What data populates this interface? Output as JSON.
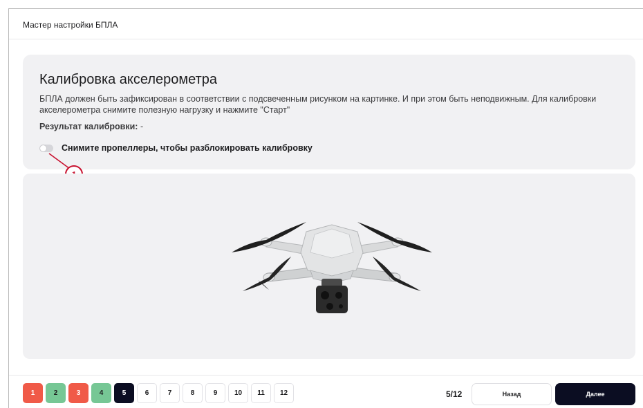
{
  "header": {
    "title": "Мастер настройки БПЛА"
  },
  "calibration": {
    "title": "Калибровка акселерометра",
    "description": "БПЛА должен быть зафиксирован в соответствии с подсвеченным рисунком на картинке. И при этом быть неподвижным. Для калибровки акселерометра снимите полезную нагрузку и нажмите \"Старт\"",
    "result_label": "Результат калибровки:",
    "result_value": "-",
    "toggle_label": "Снимите пропеллеры, чтобы разблокировать калибровку",
    "toggle_on": false
  },
  "callout": {
    "number": "1",
    "color": "#c8102e"
  },
  "steps": [
    {
      "label": "1",
      "state": "error"
    },
    {
      "label": "2",
      "state": "done"
    },
    {
      "label": "3",
      "state": "error"
    },
    {
      "label": "4",
      "state": "done"
    },
    {
      "label": "5",
      "state": "active"
    },
    {
      "label": "6",
      "state": "pending"
    },
    {
      "label": "7",
      "state": "pending"
    },
    {
      "label": "8",
      "state": "pending"
    },
    {
      "label": "9",
      "state": "pending"
    },
    {
      "label": "10",
      "state": "pending"
    },
    {
      "label": "11",
      "state": "pending"
    },
    {
      "label": "12",
      "state": "pending"
    }
  ],
  "footer": {
    "page_counter": "5/12",
    "back_label": "Назад",
    "next_label": "Далее"
  },
  "colors": {
    "error": "#f05a48",
    "done": "#76c795",
    "active": "#0b0d22",
    "card_bg": "#f1f1f3"
  },
  "image": {
    "icon": "drone-image"
  }
}
